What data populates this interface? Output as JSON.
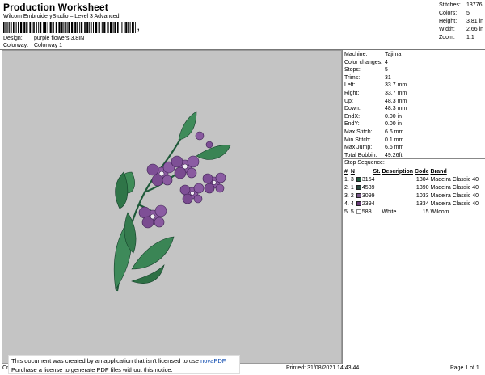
{
  "header": {
    "title": "Production Worksheet",
    "subtitle": "Wilcom EmbroideryStudio – Level 3 Advanced",
    "barcode_tail": ",",
    "design_label": "Design:",
    "design_value": "purple flowers 3,8IN",
    "colorway_label": "Colorway:",
    "colorway_value": "Colorway 1"
  },
  "stats": [
    {
      "label": "Stitches:",
      "value": "13776"
    },
    {
      "label": "Colors:",
      "value": "5"
    },
    {
      "label": "Height:",
      "value": "3.81 in"
    },
    {
      "label": "Width:",
      "value": "2.66 in"
    },
    {
      "label": "Zoom:",
      "value": "1:1"
    }
  ],
  "machine_info": [
    {
      "label": "Machine:",
      "value": "Tajima"
    },
    {
      "label": "Color changes:",
      "value": "4"
    },
    {
      "label": "Stops:",
      "value": "5"
    },
    {
      "label": "Trims:",
      "value": "31"
    },
    {
      "label": "Left:",
      "value": "33.7 mm"
    },
    {
      "label": "Right:",
      "value": "33.7 mm"
    },
    {
      "label": "Up:",
      "value": "48.3 mm"
    },
    {
      "label": "Down:",
      "value": "48.3 mm"
    },
    {
      "label": "EndX:",
      "value": "0.00 in"
    },
    {
      "label": "EndY:",
      "value": "0.00 in"
    },
    {
      "label": "Max Stitch:",
      "value": "6.6 mm"
    },
    {
      "label": "Min Stitch:",
      "value": "0.1 mm"
    },
    {
      "label": "Max Jump:",
      "value": "6.6 mm"
    },
    {
      "label": "Total Bobbin:",
      "value": "49.26ft"
    }
  ],
  "stop_sequence": {
    "title": "Stop Sequence:",
    "headers": {
      "num": "#",
      "n": "N",
      "st": "St.",
      "description": "Description",
      "code": "Code",
      "brand": "Brand"
    },
    "rows": [
      {
        "num": "1.",
        "n": "3",
        "color": "#1e5a3c",
        "st": "3154",
        "description": "",
        "code": "1304",
        "brand": "Madeira Classic 40"
      },
      {
        "num": "2.",
        "n": "1",
        "color": "#2b4a40",
        "st": "4539",
        "description": "",
        "code": "1390",
        "brand": "Madeira Classic 40"
      },
      {
        "num": "3.",
        "n": "2",
        "color": "#7a5a8c",
        "st": "3099",
        "description": "",
        "code": "1033",
        "brand": "Madeira Classic 40"
      },
      {
        "num": "4.",
        "n": "4",
        "color": "#6a3c7a",
        "st": "2394",
        "description": "",
        "code": "1334",
        "brand": "Madeira Classic 40"
      },
      {
        "num": "5.",
        "n": "5",
        "color": "#ffffff",
        "st": "588",
        "description": "White",
        "code": "15",
        "brand": "Wilcom"
      }
    ]
  },
  "notice": {
    "line1_before": "This document was created by an application that isn't licensed to use ",
    "link": "novaPDF",
    "line1_after": ".",
    "line2": "Purchase a license to generate PDF files without this notice."
  },
  "footer": {
    "left": "Cr",
    "printed": "Printed: 31/08/2021 14:43:44",
    "page": "Page 1 of 1"
  }
}
